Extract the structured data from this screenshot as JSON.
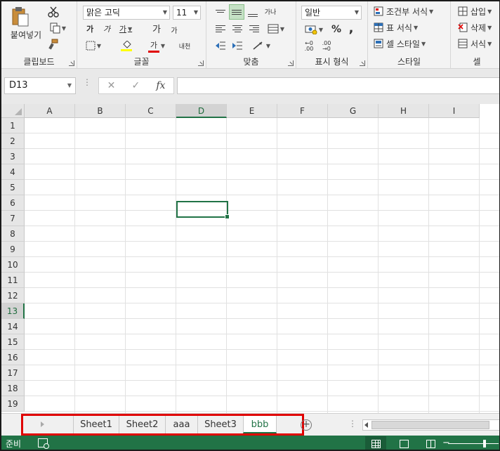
{
  "ribbon": {
    "clipboard": {
      "label": "클립보드",
      "paste_label": "붙여넣기"
    },
    "font": {
      "label": "글꼴",
      "font_name": "맑은 고딕",
      "font_size": "11",
      "bold": "가",
      "italic": "가",
      "underline": "가",
      "grow": "가",
      "shrink": "가",
      "fill_letter": "가",
      "font_color_letter": "가",
      "phonetic": "내천"
    },
    "alignment": {
      "label": "맞춤",
      "wrap": "가나"
    },
    "number": {
      "label": "표시 형식",
      "format": "일반",
      "percent": "%",
      "comma": ",",
      "inc_decimal": ".00",
      "dec_decimal": ".00"
    },
    "styles": {
      "label": "스타일",
      "conditional": "조건부 서식",
      "table": "표 서식",
      "cell_styles": "셀 스타일"
    },
    "cells": {
      "label": "셀",
      "insert": "삽입",
      "delete": "삭제",
      "format": "서식"
    }
  },
  "formula_bar": {
    "name_box": "D13",
    "fx": "fx",
    "cancel": "✕",
    "enter": "✓",
    "formula": ""
  },
  "grid": {
    "columns": [
      "A",
      "B",
      "C",
      "D",
      "E",
      "F",
      "G",
      "H",
      "I"
    ],
    "rows": [
      "1",
      "2",
      "3",
      "4",
      "5",
      "6",
      "7",
      "8",
      "9",
      "10",
      "11",
      "12",
      "13",
      "14",
      "15",
      "16",
      "17",
      "18",
      "19"
    ],
    "selected_cell": "D13"
  },
  "sheets": {
    "tabs": [
      "Sheet1",
      "Sheet2",
      "aaa",
      "Sheet3",
      "bbb"
    ],
    "active": "bbb"
  },
  "status": {
    "ready": "준비"
  },
  "colors": {
    "accent": "#217346",
    "highlight_box": "#e00000"
  }
}
